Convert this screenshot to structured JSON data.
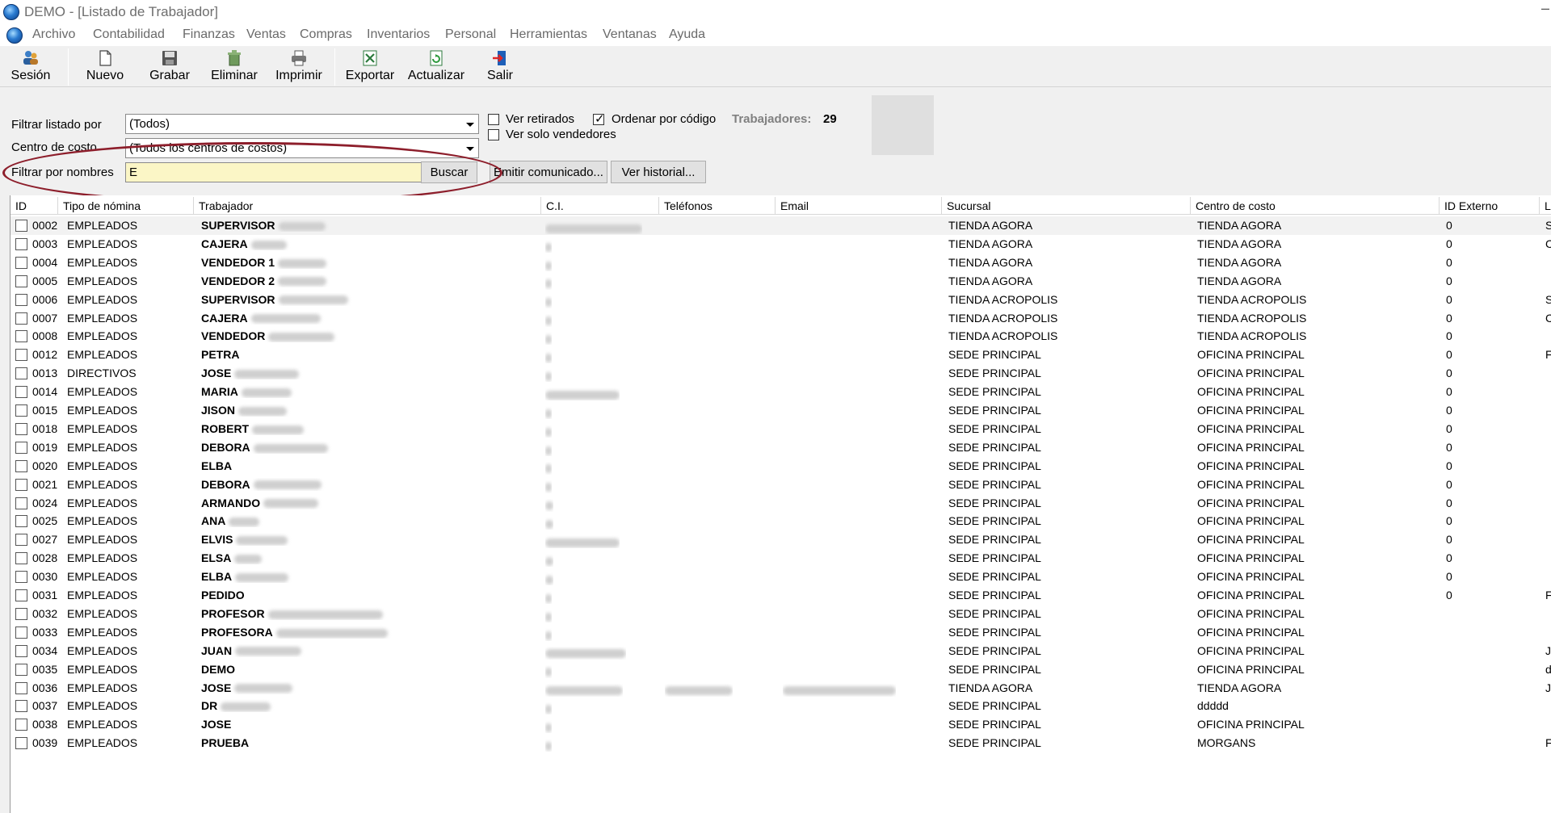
{
  "window": {
    "title": "DEMO - [Listado de Trabajador]"
  },
  "menu": [
    "Archivo",
    "Contabilidad",
    "Finanzas",
    "Ventas",
    "Compras",
    "Inventarios",
    "Personal",
    "Herramientas",
    "Ventanas",
    "Ayuda"
  ],
  "toolbar": {
    "sesion": "Sesión",
    "nuevo": "Nuevo",
    "grabar": "Grabar",
    "eliminar": "Eliminar",
    "imprimir": "Imprimir",
    "exportar": "Exportar",
    "actualizar": "Actualizar",
    "salir": "Salir"
  },
  "filters": {
    "filtrar_listado_label": "Filtrar listado por",
    "filtrar_listado_value": "(Todos)",
    "centro_label": "Centro de costo",
    "centro_value": "(Todos los centros de costos)",
    "nombres_label": "Filtrar por nombres",
    "nombres_value": "E",
    "buscar": "Buscar",
    "ver_retirados": "Ver retirados",
    "ver_retirados_checked": false,
    "ordenar_por_codigo": "Ordenar por código",
    "ordenar_por_codigo_checked": true,
    "ver_solo_vendedores": "Ver solo vendedores",
    "ver_solo_vendedores_checked": false,
    "trabajadores_label": "Trabajadores:",
    "trabajadores_count": "29",
    "emitir_comunicado": "Emitir comunicado...",
    "ver_historial": "Ver historial..."
  },
  "grid": {
    "headers": [
      "ID",
      "Tipo de nómina",
      "Trabajador",
      "C.I.",
      "Teléfonos",
      "Email",
      "Sucursal",
      "Centro de costo",
      "ID Externo",
      "L"
    ],
    "rows": [
      {
        "id": "0002",
        "tipo": "EMPLEADOS",
        "trabajador": "SUPERVISOR",
        "sucursal": "TIENDA AGORA",
        "centro": "TIENDA AGORA",
        "idext": "0",
        "l": "S"
      },
      {
        "id": "0003",
        "tipo": "EMPLEADOS",
        "trabajador": "CAJERA",
        "sucursal": "TIENDA AGORA",
        "centro": "TIENDA AGORA",
        "idext": "0",
        "l": "C"
      },
      {
        "id": "0004",
        "tipo": "EMPLEADOS",
        "trabajador": "VENDEDOR 1",
        "sucursal": "TIENDA AGORA",
        "centro": "TIENDA AGORA",
        "idext": "0",
        "l": ""
      },
      {
        "id": "0005",
        "tipo": "EMPLEADOS",
        "trabajador": "VENDEDOR 2",
        "sucursal": "TIENDA AGORA",
        "centro": "TIENDA AGORA",
        "idext": "0",
        "l": ""
      },
      {
        "id": "0006",
        "tipo": "EMPLEADOS",
        "trabajador": "SUPERVISOR",
        "sucursal": "TIENDA ACROPOLIS",
        "centro": "TIENDA ACROPOLIS",
        "idext": "0",
        "l": "S"
      },
      {
        "id": "0007",
        "tipo": "EMPLEADOS",
        "trabajador": "CAJERA",
        "sucursal": "TIENDA ACROPOLIS",
        "centro": "TIENDA ACROPOLIS",
        "idext": "0",
        "l": "C"
      },
      {
        "id": "0008",
        "tipo": "EMPLEADOS",
        "trabajador": "VENDEDOR",
        "sucursal": "TIENDA ACROPOLIS",
        "centro": "TIENDA ACROPOLIS",
        "idext": "0",
        "l": ""
      },
      {
        "id": "0012",
        "tipo": "EMPLEADOS",
        "trabajador": "PETRA",
        "sucursal": "SEDE PRINCIPAL",
        "centro": "OFICINA PRINCIPAL",
        "idext": "0",
        "l": "F"
      },
      {
        "id": "0013",
        "tipo": "DIRECTIVOS",
        "trabajador": "JOSE",
        "sucursal": "SEDE PRINCIPAL",
        "centro": "OFICINA PRINCIPAL",
        "idext": "0",
        "l": ""
      },
      {
        "id": "0014",
        "tipo": "EMPLEADOS",
        "trabajador": "MARIA",
        "sucursal": "SEDE PRINCIPAL",
        "centro": "OFICINA PRINCIPAL",
        "idext": "0",
        "l": ""
      },
      {
        "id": "0015",
        "tipo": "EMPLEADOS",
        "trabajador": "JISON",
        "sucursal": "SEDE PRINCIPAL",
        "centro": "OFICINA PRINCIPAL",
        "idext": "0",
        "l": ""
      },
      {
        "id": "0018",
        "tipo": "EMPLEADOS",
        "trabajador": "ROBERT",
        "sucursal": "SEDE PRINCIPAL",
        "centro": "OFICINA PRINCIPAL",
        "idext": "0",
        "l": ""
      },
      {
        "id": "0019",
        "tipo": "EMPLEADOS",
        "trabajador": "DEBORA",
        "sucursal": "SEDE PRINCIPAL",
        "centro": "OFICINA PRINCIPAL",
        "idext": "0",
        "l": ""
      },
      {
        "id": "0020",
        "tipo": "EMPLEADOS",
        "trabajador": "ELBA",
        "sucursal": "SEDE PRINCIPAL",
        "centro": "OFICINA PRINCIPAL",
        "idext": "0",
        "l": ""
      },
      {
        "id": "0021",
        "tipo": "EMPLEADOS",
        "trabajador": "DEBORA",
        "sucursal": "SEDE PRINCIPAL",
        "centro": "OFICINA PRINCIPAL",
        "idext": "0",
        "l": ""
      },
      {
        "id": "0024",
        "tipo": "EMPLEADOS",
        "trabajador": "ARMANDO",
        "sucursal": "SEDE PRINCIPAL",
        "centro": "OFICINA PRINCIPAL",
        "idext": "0",
        "l": ""
      },
      {
        "id": "0025",
        "tipo": "EMPLEADOS",
        "trabajador": "ANA",
        "sucursal": "SEDE PRINCIPAL",
        "centro": "OFICINA PRINCIPAL",
        "idext": "0",
        "l": ""
      },
      {
        "id": "0027",
        "tipo": "EMPLEADOS",
        "trabajador": "ELVIS",
        "sucursal": "SEDE PRINCIPAL",
        "centro": "OFICINA PRINCIPAL",
        "idext": "0",
        "l": ""
      },
      {
        "id": "0028",
        "tipo": "EMPLEADOS",
        "trabajador": "ELSA",
        "sucursal": "SEDE PRINCIPAL",
        "centro": "OFICINA PRINCIPAL",
        "idext": "0",
        "l": ""
      },
      {
        "id": "0030",
        "tipo": "EMPLEADOS",
        "trabajador": "ELBA",
        "sucursal": "SEDE PRINCIPAL",
        "centro": "OFICINA PRINCIPAL",
        "idext": "0",
        "l": ""
      },
      {
        "id": "0031",
        "tipo": "EMPLEADOS",
        "trabajador": "PEDIDO",
        "sucursal": "SEDE PRINCIPAL",
        "centro": "OFICINA PRINCIPAL",
        "idext": "0",
        "l": "F"
      },
      {
        "id": "0032",
        "tipo": "EMPLEADOS",
        "trabajador": "PROFESOR",
        "sucursal": "SEDE PRINCIPAL",
        "centro": "OFICINA PRINCIPAL",
        "idext": "",
        "l": ""
      },
      {
        "id": "0033",
        "tipo": "EMPLEADOS",
        "trabajador": "PROFESORA",
        "sucursal": "SEDE PRINCIPAL",
        "centro": "OFICINA PRINCIPAL",
        "idext": "",
        "l": ""
      },
      {
        "id": "0034",
        "tipo": "EMPLEADOS",
        "trabajador": "JUAN",
        "sucursal": "SEDE PRINCIPAL",
        "centro": "OFICINA PRINCIPAL",
        "idext": "",
        "l": "J"
      },
      {
        "id": "0035",
        "tipo": "EMPLEADOS",
        "trabajador": "DEMO",
        "sucursal": "SEDE PRINCIPAL",
        "centro": "OFICINA PRINCIPAL",
        "idext": "",
        "l": "d"
      },
      {
        "id": "0036",
        "tipo": "EMPLEADOS",
        "trabajador": "JOSE",
        "sucursal": "TIENDA AGORA",
        "centro": "TIENDA AGORA",
        "idext": "",
        "l": "J"
      },
      {
        "id": "0037",
        "tipo": "EMPLEADOS",
        "trabajador": "DR",
        "sucursal": "SEDE PRINCIPAL",
        "centro": "ddddd",
        "idext": "",
        "l": ""
      },
      {
        "id": "0038",
        "tipo": "EMPLEADOS",
        "trabajador": "JOSE",
        "sucursal": "SEDE PRINCIPAL",
        "centro": "OFICINA PRINCIPAL",
        "idext": "",
        "l": ""
      },
      {
        "id": "0039",
        "tipo": "EMPLEADOS",
        "trabajador": "PRUEBA",
        "sucursal": "SEDE PRINCIPAL",
        "centro": "MORGANS",
        "idext": "",
        "l": "F"
      }
    ]
  },
  "colors": {
    "highlight": "#8d1e2b",
    "input_bg": "#fbf6c6",
    "panel_bg": "#f0f0f0"
  }
}
